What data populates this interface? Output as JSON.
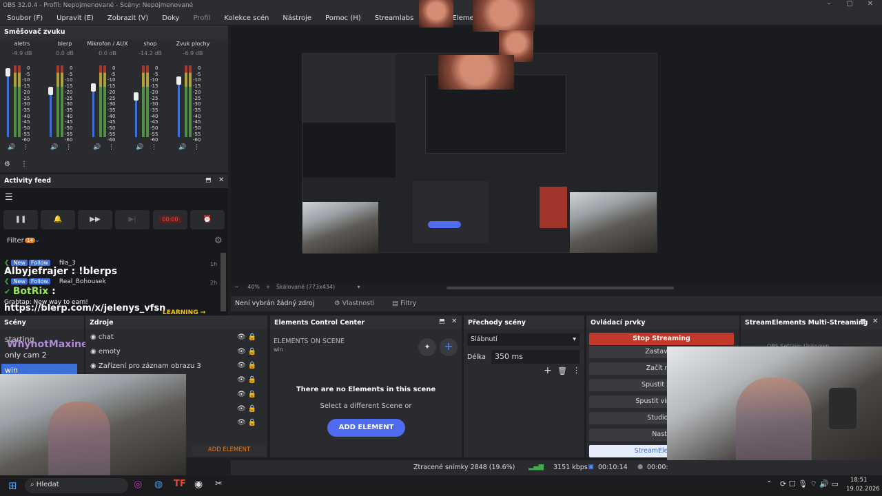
{
  "window": {
    "title": "OBS 32.0.4 - Profil: Nepojmenované - Scény: Nepojmenované"
  },
  "menu": [
    "Soubor (F)",
    "Upravit (E)",
    "Zobrazit (V)",
    "Doky",
    "Profil",
    "Kolekce scén",
    "Nástroje",
    "Pomoc (H)",
    "Streamlabs",
    "StreamElements"
  ],
  "mixer": {
    "title": "Směšovač zvuku",
    "channels": [
      {
        "name": "aletrs",
        "db": "-9.9 dB",
        "level": 0.9
      },
      {
        "name": "blerp",
        "db": "0.0 dB",
        "level": 0.64
      },
      {
        "name": "Mikrofon / AUX",
        "db": "0.0 dB",
        "level": 0.69
      },
      {
        "name": "shop",
        "db": "-14.2 dB",
        "level": 0.57
      },
      {
        "name": "Zvuk plochy",
        "db": "-6.9 dB",
        "level": 0.79
      }
    ],
    "scale": [
      "0",
      "-5",
      "-10",
      "-15",
      "-20",
      "-25",
      "-30",
      "-35",
      "-40",
      "-45",
      "-50",
      "-55",
      "-60"
    ]
  },
  "activity": {
    "title": "Activity feed",
    "filter": "Filter",
    "filter_count": "14",
    "timer": "00:00",
    "events": [
      {
        "badge1": "New",
        "badge2": "Follow",
        "user": "fila_3",
        "time": "1h"
      },
      {
        "badge1": "New",
        "badge2": "Follow",
        "user": "Real_Bohousek",
        "time": "2h"
      }
    ],
    "overlay": [
      {
        "user": "Albyjefrajer",
        "text": "!blerps"
      },
      {
        "user": "BotRix",
        "text": ""
      },
      {
        "user": "",
        "text": "Grabtap: New way to earn!"
      },
      {
        "user": "",
        "text": "https://blerp.com/x/jelenys_vfsn"
      },
      {
        "user": "",
        "text": "LEARNING →"
      }
    ]
  },
  "preview": {
    "zoom": "40%",
    "scale_label": "Škálované (773x434)"
  },
  "toolbar": {
    "no_source": "Není vybrán žádný zdroj",
    "properties": "Vlastnosti",
    "filters": "Filtry"
  },
  "scenes": {
    "title": "Scény",
    "items": [
      "starting",
      "only cam 2",
      "win"
    ],
    "overlay_user": "WhynotMaxine :"
  },
  "sources": {
    "title": "Zdroje",
    "items": [
      "chat",
      "emoty",
      "Zařízení pro záznam obrazu 3"
    ],
    "add": "ADD ELEMENT"
  },
  "elements": {
    "title": "Elements Control Center",
    "subtitle": "ELEMENTS ON SCENE",
    "scene": "win",
    "empty_title": "There are no Elements in this scene",
    "empty_sub": "Select a different Scene or",
    "button": "ADD ELEMENT"
  },
  "transitions": {
    "title": "Přechody scény",
    "type": "Slábnutí",
    "duration_label": "Délka",
    "duration": "350 ms"
  },
  "controls": {
    "title": "Ovládací prvky",
    "stop": "Stop Streaming",
    "items": [
      "Zastavit v",
      "Začít nah",
      "Spustit zázn",
      "Spustit virtuální",
      "Studiový",
      "Nasta",
      "StreamElements"
    ]
  },
  "multistream": {
    "title": "StreamElements Multi-Streaming",
    "status": "OBS Setting: Unknown"
  },
  "status": {
    "dropped": "Ztracené snímky 2848 (19.6%)",
    "bitrate": "3151 kbps",
    "time": "00:10:14",
    "rec": "00:00:"
  },
  "taskbar": {
    "search": "Hledat",
    "time": "18:51",
    "date": "19.02.2026"
  },
  "colors": {
    "accent": "#3d6fd6",
    "stop": "#c0392b",
    "elements_btn": "#4f6cf0"
  }
}
